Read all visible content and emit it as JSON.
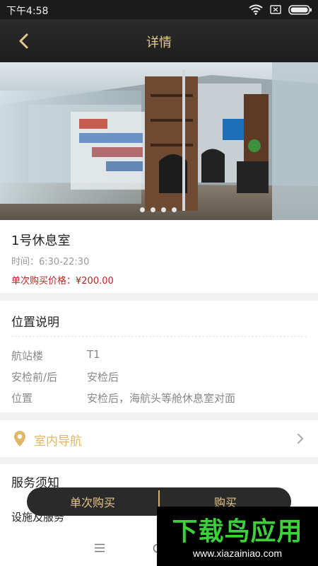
{
  "status_bar": {
    "time": "下午4:58"
  },
  "header": {
    "title": "详情"
  },
  "carousel": {
    "dot_count": 4,
    "active_dot": 3
  },
  "lounge": {
    "name": "1号休息室",
    "hours": "时间：6:30-22:30",
    "price": "单次购买价格：¥200.00"
  },
  "location": {
    "title": "位置说明",
    "rows": [
      {
        "label": "航站楼",
        "value": "T1"
      },
      {
        "label": "安检前/后",
        "value": "安检后"
      },
      {
        "label": "位置",
        "value": "安检后，海航头等舱休息室对面"
      }
    ]
  },
  "indoor_nav": {
    "label": "室内导航"
  },
  "service": {
    "title": "服务须知",
    "subtitle": "设施及服务"
  },
  "actions": {
    "single_buy": "单次购买",
    "buy": "购买"
  },
  "watermark": {
    "title": "下载鸟应用",
    "url": "www.xiazainiao.com"
  },
  "colors": {
    "accent_gold": "#e0b766",
    "price_red": "#b22222",
    "header_bg": "#1e1e1e"
  }
}
